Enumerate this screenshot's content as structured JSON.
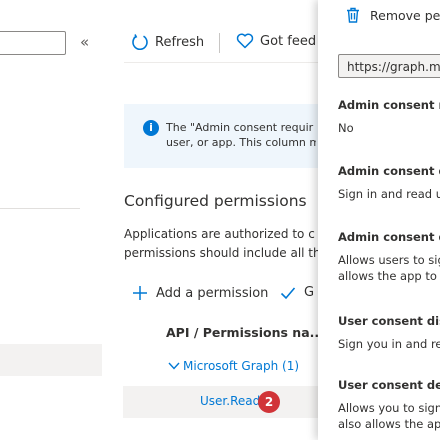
{
  "toolbar": {
    "collapse_glyph": "«",
    "refresh_label": "Refresh",
    "feedback_label": "Got feed"
  },
  "info": {
    "icon": "i",
    "line1": "The \"Admin consent requir",
    "line2": "user, or app. This column m"
  },
  "configured": {
    "heading": "Configured permissions",
    "desc_line1": "Applications are authorized to c",
    "desc_line2": "permissions should include all th",
    "add_label": "Add a permission",
    "grant_label": "G",
    "col_header": "API / Permissions na...",
    "group_label": "Microsoft Graph (1)",
    "perm_label": "User.Read",
    "badge": "2"
  },
  "panel": {
    "remove_label": "Remove pe",
    "url": "https://graph.m",
    "fields": [
      {
        "label": "Admin consent re",
        "lines": [
          "No"
        ]
      },
      {
        "label": "Admin consent di",
        "lines": [
          "Sign in and read u"
        ]
      },
      {
        "label": "Admin consent de",
        "lines": [
          "Allows users to sig",
          "allows the app to r"
        ]
      },
      {
        "label": "User consent disp",
        "lines": [
          "Sign you in and rea"
        ]
      },
      {
        "label": "User consent desc",
        "lines": [
          "Allows you to sign",
          "also allows the app"
        ]
      }
    ]
  }
}
